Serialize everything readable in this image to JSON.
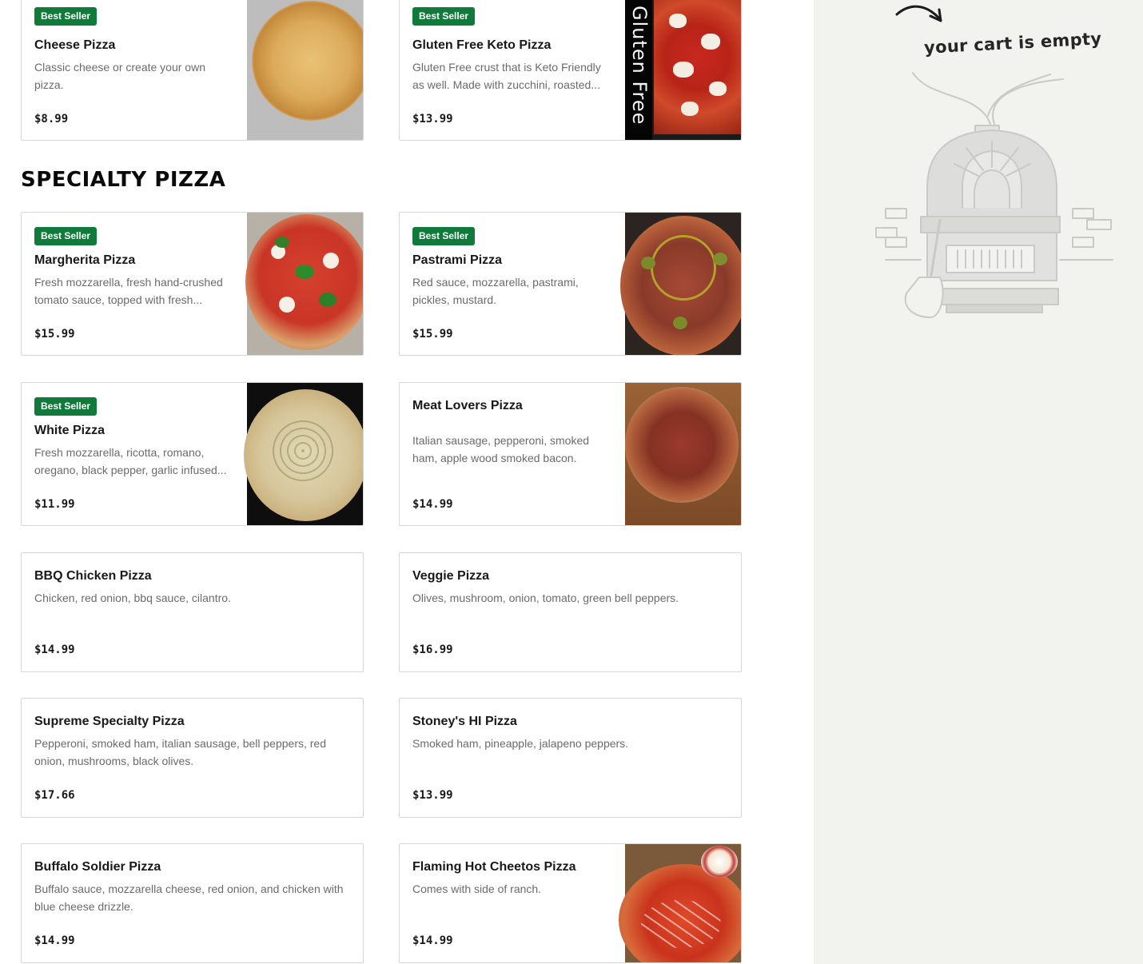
{
  "section": {
    "specialty_title": "SPECIALTY PIZZA"
  },
  "items": [
    {
      "badge": "Best Seller",
      "name": "Cheese Pizza",
      "description": "Classic cheese or create your own pizza.",
      "price": "$8.99"
    },
    {
      "badge": "Best Seller",
      "name": "Gluten Free Keto Pizza",
      "description": "Gluten Free crust that is Keto Friendly as well. Made with zucchini, roasted...",
      "price": "$13.99",
      "photo_text": "Gluten Free"
    },
    {
      "badge": "Best Seller",
      "name": "Margherita Pizza",
      "description": "Fresh mozzarella, fresh hand-crushed tomato sauce, topped with fresh...",
      "price": "$15.99"
    },
    {
      "badge": "Best Seller",
      "name": "Pastrami Pizza",
      "description": "Red sauce, mozzarella, pastrami, pickles, mustard.",
      "price": "$15.99"
    },
    {
      "badge": "Best Seller",
      "name": "White Pizza",
      "description": "Fresh mozzarella, ricotta, romano, oregano, black pepper, garlic infused...",
      "price": "$11.99"
    },
    {
      "name": "Meat Lovers Pizza",
      "description": "Italian sausage, pepperoni, smoked ham, apple wood smoked bacon.",
      "price": "$14.99"
    },
    {
      "name": "BBQ Chicken Pizza",
      "description": "Chicken, red onion, bbq sauce, cilantro.",
      "price": "$14.99"
    },
    {
      "name": "Veggie Pizza",
      "description": "Olives, mushroom, onion, tomato, green bell peppers.",
      "price": "$16.99"
    },
    {
      "name": "Supreme Specialty Pizza",
      "description": "Pepperoni, smoked ham, italian sausage, bell peppers, red onion, mushrooms, black olives.",
      "price": "$17.66"
    },
    {
      "name": "Stoney's HI Pizza",
      "description": "Smoked ham, pineapple, jalapeno peppers.",
      "price": "$13.99"
    },
    {
      "name": "Buffalo Soldier Pizza",
      "description": "Buffalo sauce, mozzarella cheese, red onion, and chicken with blue cheese drizzle.",
      "price": "$14.99"
    },
    {
      "name": "Flaming Hot Cheetos Pizza",
      "description": "Comes with side of ranch.",
      "price": "$14.99"
    }
  ],
  "cart": {
    "empty_text": "your cart is empty",
    "illustration": "pizza-oven-illustration"
  },
  "colors": {
    "badge": "#0f7a3a",
    "cart_bg": "#f2f2ef",
    "border": "#d6d6d6"
  }
}
